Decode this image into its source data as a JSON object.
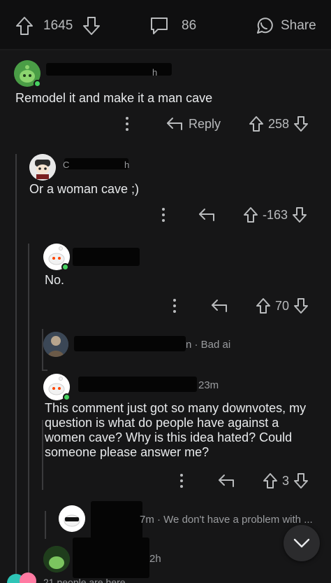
{
  "post_bar": {
    "upvote_count": "1645",
    "comment_count": "86",
    "share_label": "Share"
  },
  "comments": [
    {
      "meta": "h",
      "text": "Remodel it and make it a man cave",
      "score": "258",
      "reply_label": "Reply"
    },
    {
      "meta": "C",
      "meta_end": "h",
      "text": "Or a woman cave ;)",
      "score": "-163"
    },
    {
      "text": "No.",
      "score": "70"
    },
    {
      "meta": "n · Bad ai"
    },
    {
      "meta": "23m",
      "text": "This comment just got so many downvotes, my question is what do people have against a women cave? Why is this idea hated? Could someone please answer me?",
      "score": "3"
    },
    {
      "meta": "7m · We don't have a problem with ..."
    },
    {
      "meta": "2h"
    }
  ],
  "footer": {
    "people_here": "21 people are here"
  },
  "colors": {
    "background": "#161617",
    "online": "#46d160",
    "text": "#d7dadc"
  }
}
